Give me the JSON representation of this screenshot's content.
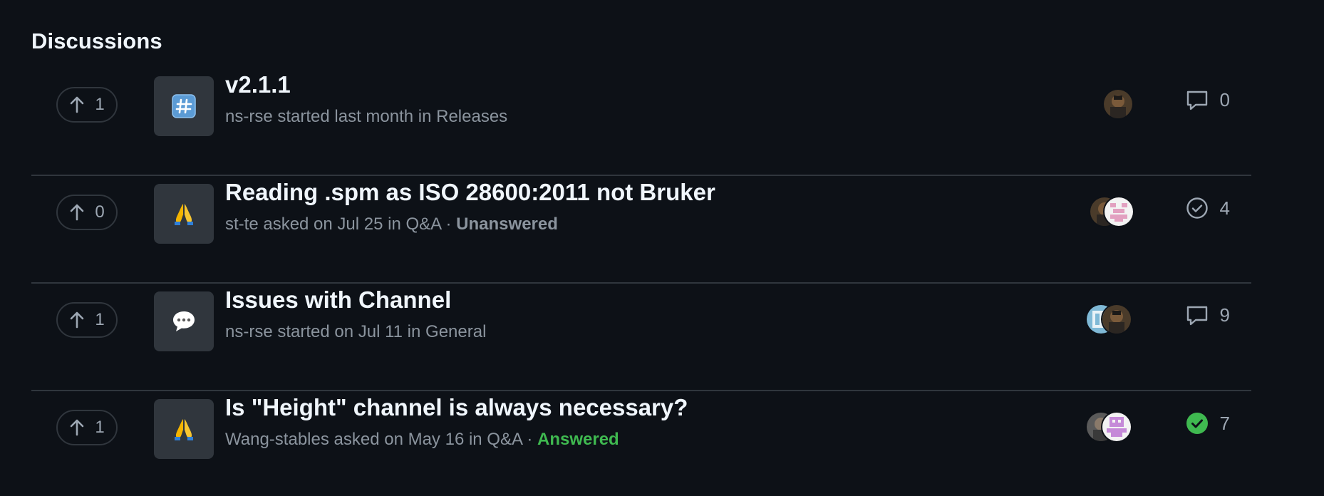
{
  "section_title": "Discussions",
  "discussions": [
    {
      "votes": "1",
      "category_icon": "hash-emoji-icon",
      "title": "v2.1.1",
      "meta": "ns-rse started last month in Releases",
      "status": "",
      "comment_icon": "comment-icon",
      "comments": "0"
    },
    {
      "votes": "0",
      "category_icon": "praying-hands-emoji-icon",
      "title": "Reading .spm as ISO 28600:2011 not Bruker",
      "meta": "st-te asked on Jul 25 in Q&A · ",
      "status": "Unanswered",
      "comment_icon": "check-circle-outline-icon",
      "comments": "4"
    },
    {
      "votes": "1",
      "category_icon": "speech-balloon-emoji-icon",
      "title": "Issues with Channel",
      "meta": "ns-rse started on Jul 11 in General",
      "status": "",
      "comment_icon": "comment-icon",
      "comments": "9"
    },
    {
      "votes": "1",
      "category_icon": "praying-hands-emoji-icon",
      "title": "Is \"Height\" channel is always necessary?",
      "meta": "Wang-stables asked on May 16 in Q&A · ",
      "status": "Answered",
      "comment_icon": "check-circle-filled-icon",
      "comments": "7"
    }
  ],
  "colors": {
    "background": "#0d1117",
    "border": "#30363d",
    "answered": "#3fb950",
    "muted": "#8b949e"
  }
}
